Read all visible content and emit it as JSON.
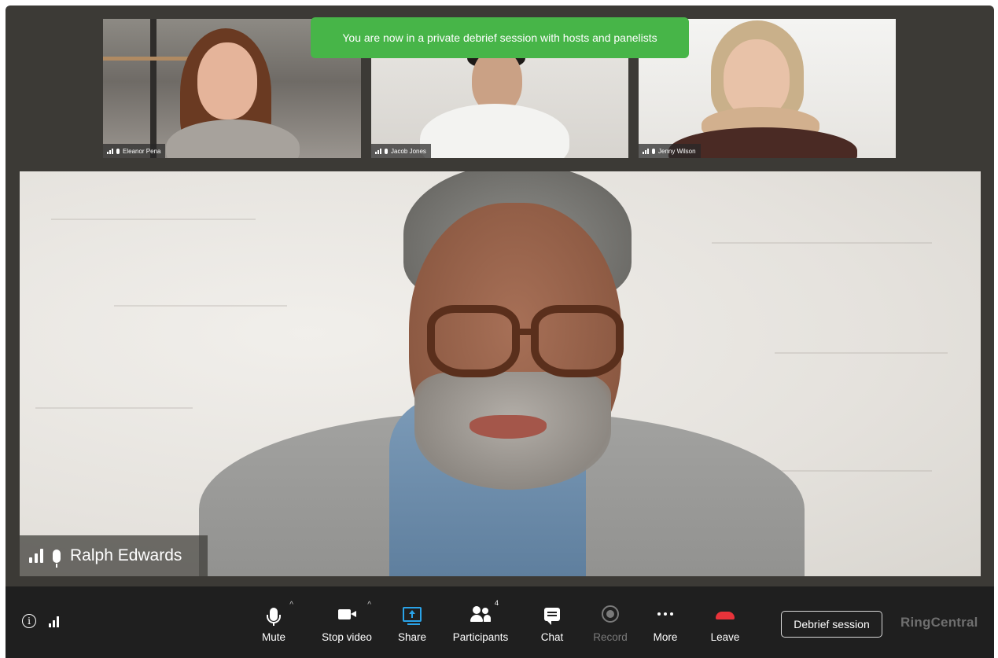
{
  "banner": {
    "text": "You are now in a private debrief session with hosts and panelists"
  },
  "thumbnails": [
    {
      "name": "Eleanor Pena"
    },
    {
      "name": "Jacob Jones"
    },
    {
      "name": "Jenny Wilson"
    }
  ],
  "main_speaker": {
    "name": "Ralph Edwards"
  },
  "toolbar": {
    "mute_label": "Mute",
    "stop_video_label": "Stop video",
    "share_label": "Share",
    "participants_label": "Participants",
    "participants_count": "4",
    "chat_label": "Chat",
    "record_label": "Record",
    "more_label": "More",
    "leave_label": "Leave",
    "debrief_label": "Debrief session",
    "brand": "RingCentral"
  },
  "icons": {
    "info": "info-icon",
    "signal": "signal-icon",
    "mic": "microphone-icon",
    "camera": "video-camera-icon",
    "share": "screen-share-icon",
    "participants": "people-icon",
    "chat": "chat-bubble-icon",
    "record": "record-icon",
    "more": "ellipsis-icon",
    "leave": "phone-hangup-icon"
  },
  "colors": {
    "banner": "#47b548",
    "share_accent": "#2aa3e8",
    "leave": "#e8333a",
    "toolbar_bg": "#1f1f1f",
    "stage_bg": "#3c3a36"
  }
}
